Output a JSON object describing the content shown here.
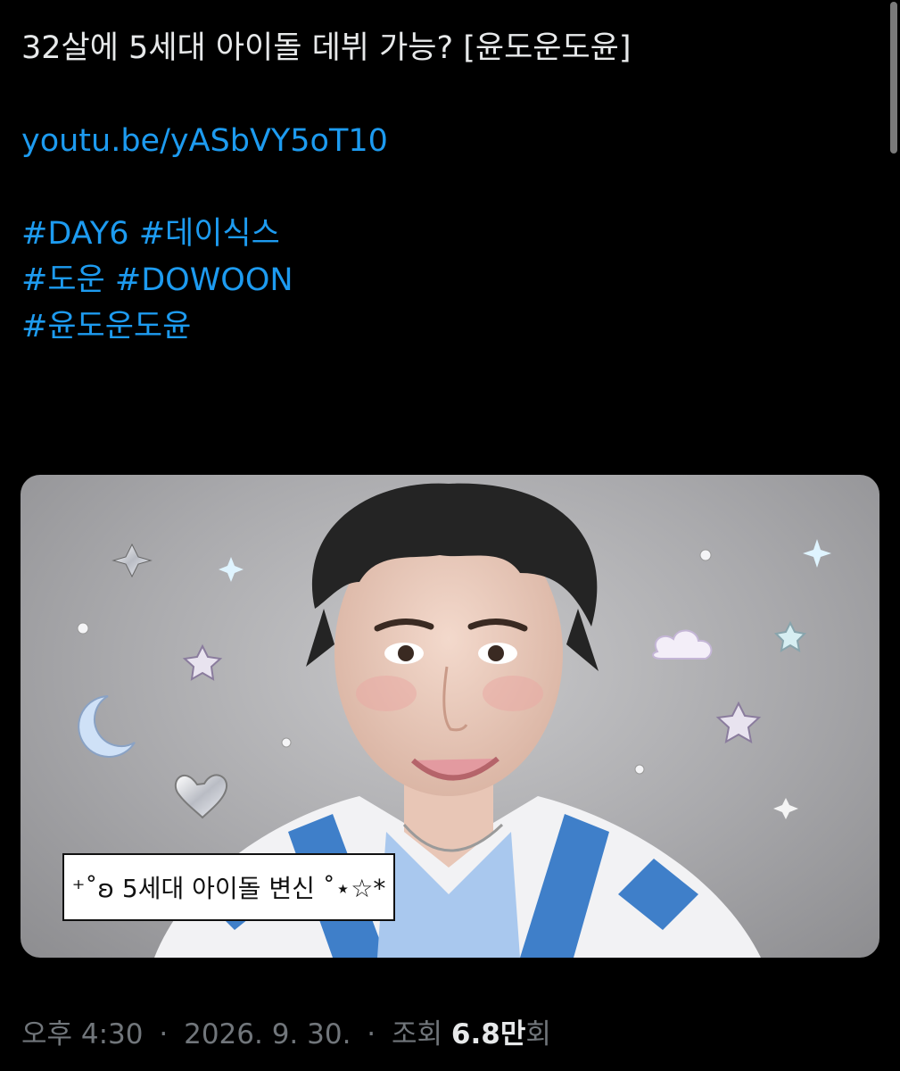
{
  "tweet": {
    "title_line": "32살에 5세대 아이돌 데뷔 가능? [윤도운도윤]",
    "link": "youtu.be/yASbVY5oT10",
    "hashtags_line1": [
      "#DAY6",
      "#데이식스"
    ],
    "hashtags_line2": [
      "#도운",
      "#DOWOON"
    ],
    "hashtags_line3": [
      "#윤도운도윤"
    ]
  },
  "media": {
    "caption": "⁺˚ʚ 5세대 아이돌 변신 ˚⋆☆*",
    "icons": [
      "sparkle-star-icon",
      "moon-icon",
      "heart-icon",
      "cloud-icon",
      "star-icon"
    ]
  },
  "meta": {
    "time": "오후 4:30",
    "date": "2026. 9. 30.",
    "views_label": "조회",
    "views_count": "6.8만",
    "views_suffix": "회",
    "separator": "·"
  },
  "colors": {
    "background": "#000000",
    "text": "#e7e9ea",
    "link": "#1d9bf0",
    "muted": "#71767b"
  }
}
